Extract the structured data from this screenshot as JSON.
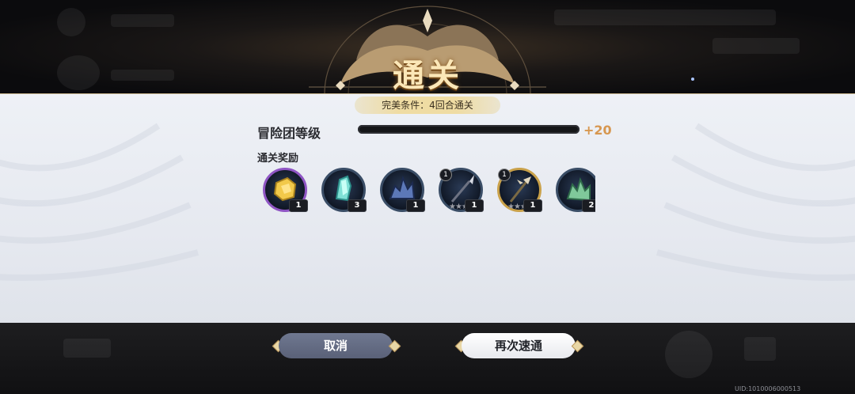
{
  "title": "通关",
  "condition": "完美条件：4回合通关",
  "level": {
    "label": "冒险团等级",
    "progress": 1.0,
    "gain": "+20"
  },
  "rewards": {
    "label": "通关奖励",
    "items": [
      {
        "icon": "gold-ore-icon",
        "quantity": "1",
        "tier": "",
        "frame": "purple",
        "colors": [
          "#f2c94a",
          "#a8801c"
        ]
      },
      {
        "icon": "teal-crystal-icon",
        "quantity": "3",
        "tier": "",
        "frame": "blue",
        "colors": [
          "#7fe0d6",
          "#2c8f8a"
        ]
      },
      {
        "icon": "dark-crystal-icon",
        "quantity": "1",
        "tier": "",
        "frame": "blue",
        "colors": [
          "#5c78b8",
          "#1c2a4f"
        ]
      },
      {
        "icon": "spear-icon",
        "quantity": "1",
        "tier": "1",
        "frame": "blue",
        "colors": [
          "#d6d9e2",
          "#6d7282"
        ]
      },
      {
        "icon": "halberd-icon",
        "quantity": "1",
        "tier": "1",
        "frame": "gold",
        "colors": [
          "#e3d9c0",
          "#7b6a44"
        ]
      },
      {
        "icon": "green-crystal-icon",
        "quantity": "2",
        "tier": "",
        "frame": "blue",
        "colors": [
          "#7fc89a",
          "#2f6b4a"
        ]
      }
    ]
  },
  "buttons": {
    "cancel": "取消",
    "again": "再次速通"
  },
  "uid": "UID:1010006000513",
  "colors": {
    "accent_gold": "#d79750",
    "panel": "#eef1f6"
  }
}
